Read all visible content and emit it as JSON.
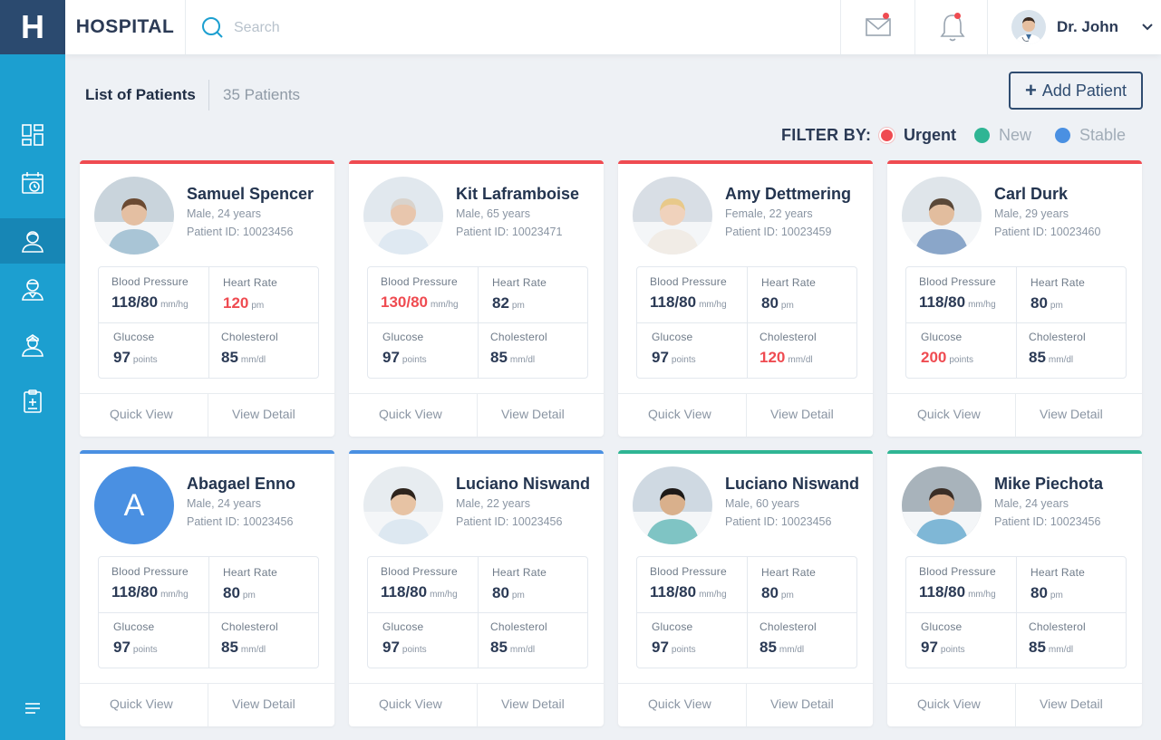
{
  "app": {
    "logo": "H",
    "name": "HOSPITAL"
  },
  "search": {
    "placeholder": "Search"
  },
  "user": {
    "name": "Dr. John"
  },
  "colors": {
    "sidebar": "#1c9fd0",
    "logo_bg": "#2b4a6f",
    "urgent": "#ef4b51",
    "new": "#2fb594",
    "stable": "#4a90e2",
    "alert_text": "#ef4b51"
  },
  "sidebar": {
    "items": [
      {
        "icon": "dashboard-icon"
      },
      {
        "icon": "calendar-clock-icon"
      },
      {
        "icon": "patient-icon",
        "active": true
      },
      {
        "icon": "doctor-icon"
      },
      {
        "icon": "nurse-icon"
      },
      {
        "icon": "clipboard-medical-icon"
      }
    ],
    "menu_icon": "menu-icon"
  },
  "header": {
    "title": "List of Patients",
    "count": "35 Patients",
    "add_label": "Add Patient"
  },
  "filter": {
    "label": "FILTER BY:",
    "options": [
      {
        "label": "Urgent",
        "color": "#ef4b51",
        "selected": true
      },
      {
        "label": "New",
        "color": "#2fb594",
        "selected": false
      },
      {
        "label": "Stable",
        "color": "#4a90e2",
        "selected": false
      }
    ]
  },
  "labels": {
    "blood_pressure": "Blood Pressure",
    "heart_rate": "Heart Rate",
    "glucose": "Glucose",
    "cholesterol": "Cholesterol",
    "bp_unit": "mm/hg",
    "hr_unit": "pm",
    "glucose_unit": "points",
    "chol_unit": "mm/dl",
    "quick_view": "Quick View",
    "view_detail": "View Detail"
  },
  "patients": [
    {
      "name": "Samuel Spencer",
      "info": "Male, 24 years",
      "pid": "Patient ID: 10023456",
      "status": "urgent",
      "bp": "118/80",
      "hr": "120",
      "glucose": "97",
      "chol": "85",
      "alert": "hr"
    },
    {
      "name": "Kit Laframboise",
      "info": "Male, 65 years",
      "pid": "Patient ID: 10023471",
      "status": "urgent",
      "bp": "130/80",
      "hr": "82",
      "glucose": "97",
      "chol": "85",
      "alert": "bp"
    },
    {
      "name": "Amy Dettmering",
      "info": "Female, 22 years",
      "pid": "Patient ID: 10023459",
      "status": "urgent",
      "bp": "118/80",
      "hr": "80",
      "glucose": "97",
      "chol": "120",
      "alert": "chol"
    },
    {
      "name": "Carl Durk",
      "info": "Male, 29 years",
      "pid": "Patient ID: 10023460",
      "status": "urgent",
      "bp": "118/80",
      "hr": "80",
      "glucose": "200",
      "chol": "85",
      "alert": "glucose"
    },
    {
      "name": "Abagael Enno",
      "info": "Male, 24 years",
      "pid": "Patient ID: 10023456",
      "status": "stable",
      "initial": "A",
      "bp": "118/80",
      "hr": "80",
      "glucose": "97",
      "chol": "85",
      "alert": ""
    },
    {
      "name": "Luciano Niswand",
      "info": "Male, 22 years",
      "pid": "Patient ID: 10023456",
      "status": "stable",
      "bp": "118/80",
      "hr": "80",
      "glucose": "97",
      "chol": "85",
      "alert": ""
    },
    {
      "name": "Luciano Niswand",
      "info": "Male, 60 years",
      "pid": "Patient ID: 10023456",
      "status": "new",
      "bp": "118/80",
      "hr": "80",
      "glucose": "97",
      "chol": "85",
      "alert": ""
    },
    {
      "name": "Mike Piechota",
      "info": "Male, 24 years",
      "pid": "Patient ID: 10023456",
      "status": "new",
      "bp": "118/80",
      "hr": "80",
      "glucose": "97",
      "chol": "85",
      "alert": ""
    }
  ]
}
